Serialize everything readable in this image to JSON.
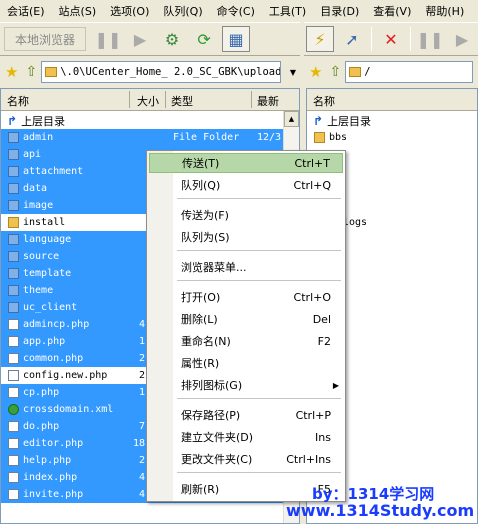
{
  "menu": [
    {
      "label": "会话(E)"
    },
    {
      "label": "站点(S)"
    },
    {
      "label": "选项(O)"
    },
    {
      "label": "队列(Q)"
    },
    {
      "label": "命令(C)"
    },
    {
      "label": "工具(T)"
    },
    {
      "label": "目录(D)"
    },
    {
      "label": "查看(V)"
    },
    {
      "label": "帮助(H)"
    }
  ],
  "toolbar": {
    "local_browser_label": "本地浏览器"
  },
  "left_address": {
    "path": "\\.0\\UCenter_Home_ 2.0_SC_GBK\\upload"
  },
  "right_address": {
    "path": "/"
  },
  "left_columns": {
    "name": "名称",
    "size": "大小",
    "type": "类型",
    "date": "最新"
  },
  "right_columns": {
    "name": "名称"
  },
  "parent_dir": "上层目录",
  "left_rows": [
    {
      "name": "admin",
      "size": "",
      "type": "File Folder",
      "date": "12/3",
      "kind": "folder",
      "selected": true
    },
    {
      "name": "api",
      "size": "",
      "type": "",
      "date": "",
      "kind": "folder",
      "selected": true
    },
    {
      "name": "attachment",
      "size": "",
      "type": "",
      "date": "",
      "kind": "folder",
      "selected": true
    },
    {
      "name": "data",
      "size": "",
      "type": "",
      "date": "",
      "kind": "folder",
      "selected": true
    },
    {
      "name": "image",
      "size": "",
      "type": "",
      "date": "",
      "kind": "folder",
      "selected": true
    },
    {
      "name": "install",
      "size": "",
      "type": "",
      "date": "",
      "kind": "folder",
      "selected": false
    },
    {
      "name": "language",
      "size": "",
      "type": "",
      "date": "",
      "kind": "folder",
      "selected": true
    },
    {
      "name": "source",
      "size": "",
      "type": "",
      "date": "",
      "kind": "folder",
      "selected": true
    },
    {
      "name": "template",
      "size": "",
      "type": "",
      "date": "",
      "kind": "folder",
      "selected": true
    },
    {
      "name": "theme",
      "size": "",
      "type": "",
      "date": "",
      "kind": "folder",
      "selected": true
    },
    {
      "name": "uc_client",
      "size": "",
      "type": "",
      "date": "",
      "kind": "folder",
      "selected": true
    },
    {
      "name": "admincp.php",
      "size": "4",
      "type": "",
      "date": "",
      "kind": "file",
      "selected": true
    },
    {
      "name": "app.php",
      "size": "1",
      "type": "",
      "date": "",
      "kind": "file",
      "selected": true
    },
    {
      "name": "common.php",
      "size": "2",
      "type": "",
      "date": "",
      "kind": "file",
      "selected": true
    },
    {
      "name": "config.new.php",
      "size": "2",
      "type": "",
      "date": "",
      "kind": "file",
      "selected": false
    },
    {
      "name": "cp.php",
      "size": "1",
      "type": "",
      "date": "",
      "kind": "file",
      "selected": true
    },
    {
      "name": "crossdomain.xml",
      "size": "",
      "type": "",
      "date": "",
      "kind": "xml",
      "selected": true
    },
    {
      "name": "do.php",
      "size": "7",
      "type": "",
      "date": "",
      "kind": "file",
      "selected": true
    },
    {
      "name": "editor.php",
      "size": "18",
      "type": "",
      "date": "",
      "kind": "file",
      "selected": true
    },
    {
      "name": "help.php",
      "size": "2",
      "type": "",
      "date": "",
      "kind": "file",
      "selected": true
    },
    {
      "name": "index.php",
      "size": "4",
      "type": "",
      "date": "",
      "kind": "file",
      "selected": true
    },
    {
      "name": "invite.php",
      "size": "4",
      "type": "",
      "date": "",
      "kind": "file",
      "selected": true
    }
  ],
  "right_rows": [
    {
      "name": "bbs"
    }
  ],
  "right_partial_text": "logs",
  "context_menu": {
    "items": [
      {
        "label": "传送(T)",
        "shortcut": "Ctrl+T",
        "highlighted": true
      },
      {
        "label": "队列(Q)",
        "shortcut": "Ctrl+Q"
      },
      {
        "label": "传送为(F)",
        "shortcut": ""
      },
      {
        "label": "队列为(S)",
        "shortcut": ""
      },
      {
        "label": "浏览器菜单...",
        "shortcut": ""
      },
      {
        "label": "打开(O)",
        "shortcut": "Ctrl+O"
      },
      {
        "label": "删除(L)",
        "shortcut": "Del"
      },
      {
        "label": "重命名(N)",
        "shortcut": "F2"
      },
      {
        "label": "属性(R)",
        "shortcut": ""
      },
      {
        "label": "排列图标(G)",
        "shortcut": "",
        "submenu": true
      },
      {
        "label": "保存路径(P)",
        "shortcut": "Ctrl+P"
      },
      {
        "label": "建立文件夹(D)",
        "shortcut": "Ins"
      },
      {
        "label": "更改文件夹(C)",
        "shortcut": "Ctrl+Ins"
      },
      {
        "label": "刷新(R)",
        "shortcut": "F5"
      }
    ]
  },
  "watermark": {
    "line1": "by：1314学习网",
    "line2": "www.1314Study.com"
  }
}
